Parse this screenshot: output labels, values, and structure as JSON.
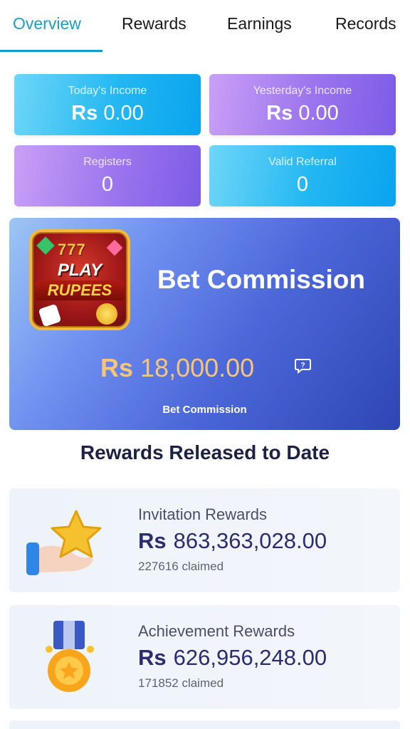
{
  "tabs": [
    {
      "label": "Overview",
      "active": true
    },
    {
      "label": "Rewards",
      "active": false
    },
    {
      "label": "Earnings",
      "active": false
    },
    {
      "label": "Records",
      "active": false
    }
  ],
  "stats": {
    "today_income": {
      "label": "Today's Income",
      "currency": "Rs",
      "value": "0.00"
    },
    "yesterday_income": {
      "label": "Yesterday's Income",
      "currency": "Rs",
      "value": "0.00"
    },
    "registers": {
      "label": "Registers",
      "value": "0"
    },
    "valid_referral": {
      "label": "Valid Referral",
      "value": "0"
    }
  },
  "commission": {
    "logo": {
      "sevens": "777",
      "play": "PLAY",
      "rupees": "RUPEES"
    },
    "title": "Bet Commission",
    "currency": "Rs",
    "amount": "18,000.00",
    "help_icon": "question-bubble-icon",
    "label": "Bet Commission"
  },
  "rewards_section": {
    "title": "Rewards Released to Date",
    "items": [
      {
        "name": "Invitation Rewards",
        "currency": "Rs",
        "amount": "863,363,028.00",
        "claimed": "227616 claimed",
        "icon": "hand-star-icon"
      },
      {
        "name": "Achievement Rewards",
        "currency": "Rs",
        "amount": "626,956,248.00",
        "claimed": "171852 claimed",
        "icon": "medal-icon"
      }
    ]
  },
  "colors": {
    "accent": "#1a9fc4",
    "card_blue": "#22b7f2",
    "card_purple": "#9b74ee",
    "commission_amount": "#f7c57a",
    "reward_amount": "#2b2d6e"
  }
}
